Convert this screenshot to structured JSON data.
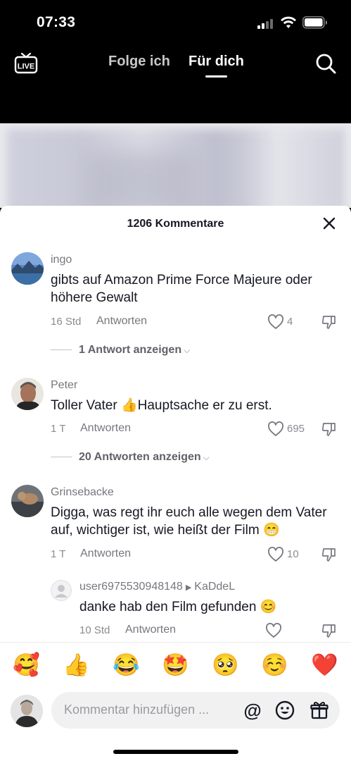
{
  "status": {
    "time": "07:33"
  },
  "nav": {
    "live_label": "LIVE",
    "tabs": [
      {
        "label": "Folge ich"
      },
      {
        "label": "Für dich"
      }
    ]
  },
  "sheet": {
    "title": "1206 Kommentare",
    "reply_label": "Antworten",
    "comments": [
      {
        "user": "ingo",
        "text": "gibts auf Amazon Prime Force Majeure oder höhere Gewalt",
        "time": "16 Std",
        "likes": "4",
        "view_replies": "1 Antwort anzeigen"
      },
      {
        "user": "Peter",
        "text_a": "Toller Vater ",
        "emoji": "👍",
        "text_b": "Hauptsache er zu erst.",
        "time": "1 T",
        "likes": "695",
        "view_replies": "20 Antworten anzeigen"
      },
      {
        "user": "Grinsebacke",
        "text": "Digga, was regt ihr euch alle wegen dem Vater auf, wichtiger ist, wie heißt der Film ",
        "emoji": "😁",
        "time": "1 T",
        "likes": "10"
      },
      {
        "user": "user6975530948148",
        "reply_to": "KaDdeL",
        "text": "danke hab den Film gefunden ",
        "emoji": "😊",
        "time": "10 Std"
      }
    ]
  },
  "emoji_bar": [
    "🥰",
    "👍",
    "😂",
    "🤩",
    "🥺",
    "☺️",
    "❤️"
  ],
  "input": {
    "placeholder": "Kommentar hinzufügen ..."
  },
  "colors": {
    "heart_red": "#fe2c55",
    "text": "#161823",
    "muted": "#8a8b91"
  }
}
